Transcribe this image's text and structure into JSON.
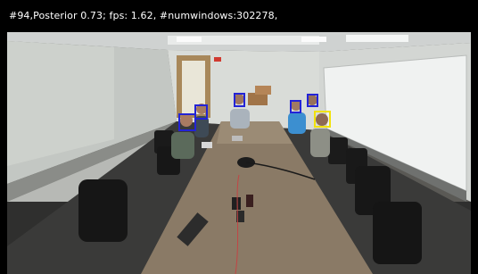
{
  "status_line": "#94,Posterior 0.73; fps: 1.62, #numwindows:302278,",
  "overlay_colors": {
    "face_box": "#2323d6",
    "highlight_box": "#f2e20a"
  },
  "detections": [
    {
      "kind": "face"
    },
    {
      "kind": "face"
    },
    {
      "kind": "face"
    },
    {
      "kind": "face"
    },
    {
      "kind": "face"
    },
    {
      "kind": "face"
    },
    {
      "kind": "highlight"
    }
  ]
}
